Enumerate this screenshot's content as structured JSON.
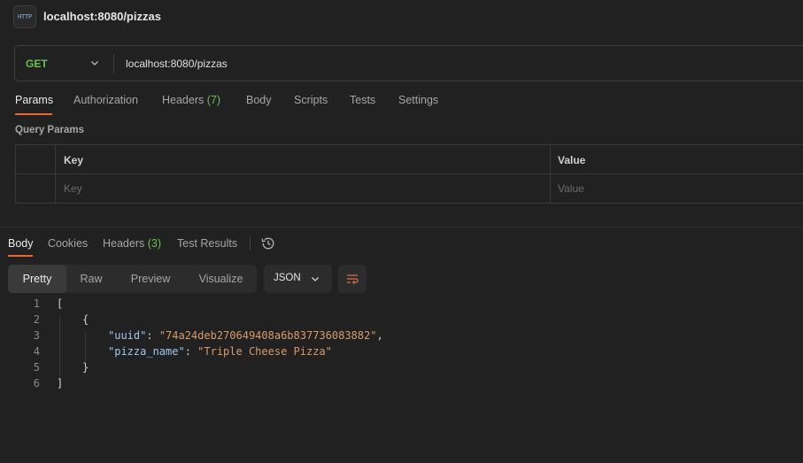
{
  "tab": {
    "icon_text": "HTTP",
    "title": "localhost:8080/pizzas"
  },
  "request": {
    "method": "GET",
    "url": "localhost:8080/pizzas"
  },
  "request_tabs": [
    {
      "label": "Params"
    },
    {
      "label": "Authorization"
    },
    {
      "label": "Headers",
      "count": "(7)"
    },
    {
      "label": "Body"
    },
    {
      "label": "Scripts"
    },
    {
      "label": "Tests"
    },
    {
      "label": "Settings"
    }
  ],
  "query_params": {
    "title": "Query Params",
    "headers": {
      "key": "Key",
      "value": "Value"
    },
    "placeholders": {
      "key": "Key",
      "value": "Value"
    }
  },
  "response_tabs": [
    {
      "label": "Body"
    },
    {
      "label": "Cookies"
    },
    {
      "label": "Headers",
      "count": "(3)"
    },
    {
      "label": "Test Results"
    }
  ],
  "format_options": [
    "Pretty",
    "Raw",
    "Preview",
    "Visualize"
  ],
  "language": "JSON",
  "code_lines": [
    {
      "num": "1",
      "parts": [
        {
          "t": "[",
          "c": "punc"
        }
      ]
    },
    {
      "num": "2",
      "parts": [
        {
          "t": "{",
          "c": "punc"
        }
      ]
    },
    {
      "num": "3",
      "parts": [
        {
          "t": "\"uuid\"",
          "c": "ckey"
        },
        {
          "t": ": ",
          "c": "punc"
        },
        {
          "t": "\"74a24deb270649408a6b837736083882\"",
          "c": "cstr"
        },
        {
          "t": ",",
          "c": "punc"
        }
      ]
    },
    {
      "num": "4",
      "parts": [
        {
          "t": "\"pizza_name\"",
          "c": "ckey"
        },
        {
          "t": ": ",
          "c": "punc"
        },
        {
          "t": "\"Triple Cheese Pizza\"",
          "c": "cstr"
        }
      ]
    },
    {
      "num": "5",
      "parts": [
        {
          "t": "}",
          "c": "punc"
        }
      ]
    },
    {
      "num": "6",
      "parts": [
        {
          "t": "]",
          "c": "punc"
        }
      ]
    }
  ],
  "colors": {
    "accent": "#e06b3a",
    "method_get": "#6bc04f",
    "json_key": "#9cc8f0",
    "json_string": "#d79b6c"
  }
}
